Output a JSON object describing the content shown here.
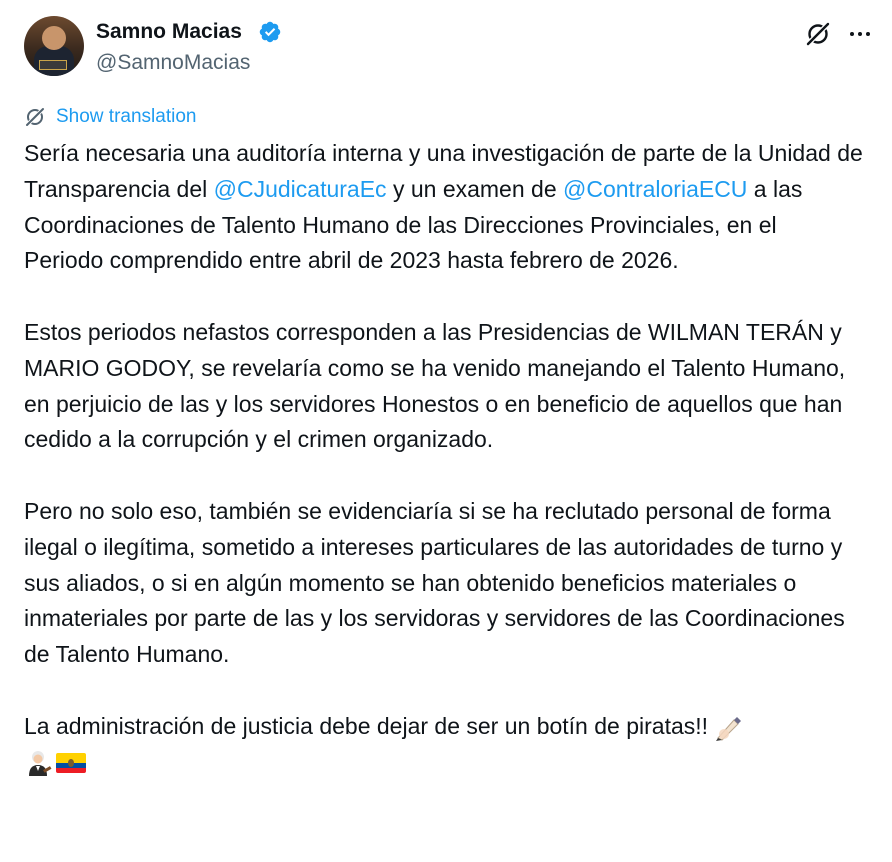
{
  "author": {
    "name": "Samno Macias",
    "handle": "@SamnoMacias",
    "avatar_icon": "profile-photo",
    "verified_icon": "verified-badge-icon"
  },
  "actions": {
    "grok_icon": "grok-icon",
    "more_icon": "more-icon"
  },
  "translation": {
    "label": "Show translation",
    "icon": "translate-icon"
  },
  "tweet": {
    "p1": {
      "a": "Sería necesaria una auditoría interna y una investigación de parte de la Unidad de Transparencia del ",
      "m1": "@CJudicaturaEc",
      "b": "  y un examen de ",
      "m2": "@ContraloriaECU",
      "c": " a las Coordinaciones de Talento Humano de las Direcciones Provinciales, en el",
      "d": "Periodo comprendido entre abril de 2023 hasta febrero de 2026."
    },
    "p2": "Estos periodos nefastos corresponden a las Presidencias de WILMAN TERÁN y MARIO GODOY, se revelaría como se ha venido manejando el Talento Humano, en perjuicio de las y los servidores Honestos o en beneficio de aquellos que han cedido  a la corrupción y el crimen organizado.",
    "p3": "Pero no solo eso, también se evidenciaría si se ha reclutado personal de forma ilegal o ilegítima, sometido a intereses particulares de las autoridades de turno y sus aliados, o si en algún momento se han obtenido beneficios materiales o inmateriales por parte de las y los servidoras y servidores de las Coordinaciones de Talento Humano.",
    "p4": "La administración de justicia debe dejar de ser un botín de piratas!!",
    "emojis": [
      "writing-hand-emoji",
      "judge-emoji",
      "ecuador-flag-emoji"
    ]
  },
  "colors": {
    "text": "#0f1419",
    "secondary": "#536471",
    "accent": "#1d9bf0"
  }
}
